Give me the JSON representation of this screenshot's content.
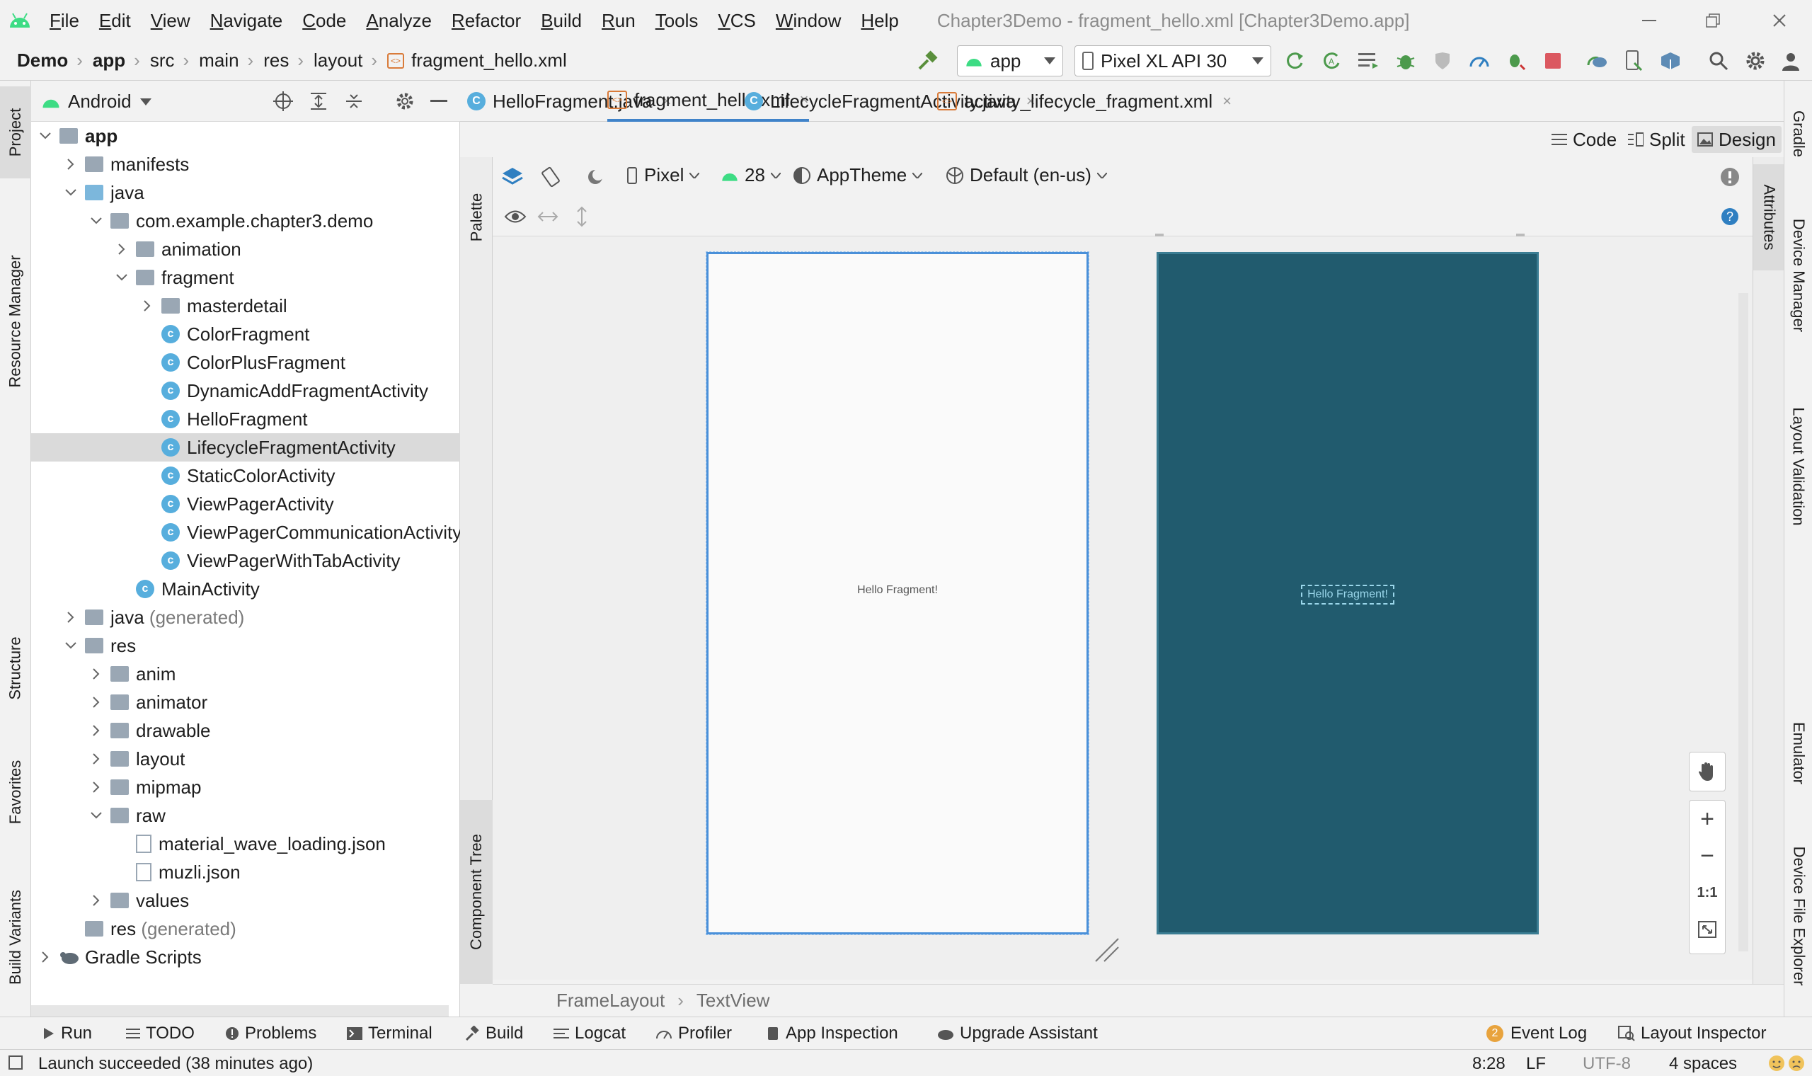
{
  "menu": [
    "File",
    "Edit",
    "View",
    "Navigate",
    "Code",
    "Analyze",
    "Refactor",
    "Build",
    "Run",
    "Tools",
    "VCS",
    "Window",
    "Help"
  ],
  "window_title": "Chapter3Demo - fragment_hello.xml [Chapter3Demo.app]",
  "breadcrumbs": [
    "Demo",
    "app",
    "src",
    "main",
    "res",
    "layout",
    "fragment_hello.xml"
  ],
  "run_config": "app",
  "device": "Pixel XL API 30",
  "left_tabs": [
    "Project",
    "Resource Manager",
    "Structure",
    "Favorites",
    "Build Variants"
  ],
  "project_view": "Android",
  "tree": [
    {
      "label": "app",
      "level": 0,
      "type": "module",
      "expanded": true
    },
    {
      "label": "manifests",
      "level": 1,
      "type": "folder",
      "expanded": false
    },
    {
      "label": "java",
      "level": 1,
      "type": "folder",
      "expanded": true
    },
    {
      "label": "com.example.chapter3.demo",
      "level": 2,
      "type": "package",
      "expanded": true
    },
    {
      "label": "animation",
      "level": 3,
      "type": "package",
      "expanded": false
    },
    {
      "label": "fragment",
      "level": 3,
      "type": "package",
      "expanded": true
    },
    {
      "label": "masterdetail",
      "level": 4,
      "type": "package",
      "expanded": false
    },
    {
      "label": "ColorFragment",
      "level": 4,
      "type": "class"
    },
    {
      "label": "ColorPlusFragment",
      "level": 4,
      "type": "class"
    },
    {
      "label": "DynamicAddFragmentActivity",
      "level": 4,
      "type": "class"
    },
    {
      "label": "HelloFragment",
      "level": 4,
      "type": "class"
    },
    {
      "label": "LifecycleFragmentActivity",
      "level": 4,
      "type": "class",
      "selected": true
    },
    {
      "label": "StaticColorActivity",
      "level": 4,
      "type": "class"
    },
    {
      "label": "ViewPagerActivity",
      "level": 4,
      "type": "class"
    },
    {
      "label": "ViewPagerCommunicationActivity",
      "level": 4,
      "type": "class"
    },
    {
      "label": "ViewPagerWithTabActivity",
      "level": 4,
      "type": "class"
    },
    {
      "label": "MainActivity",
      "level": 3,
      "type": "class"
    },
    {
      "label": "java",
      "suffix": " (generated)",
      "level": 1,
      "type": "folder",
      "expanded": false
    },
    {
      "label": "res",
      "level": 1,
      "type": "folder",
      "expanded": true
    },
    {
      "label": "anim",
      "level": 2,
      "type": "folder",
      "expanded": false
    },
    {
      "label": "animator",
      "level": 2,
      "type": "folder",
      "expanded": false
    },
    {
      "label": "drawable",
      "level": 2,
      "type": "folder",
      "expanded": false
    },
    {
      "label": "layout",
      "level": 2,
      "type": "folder",
      "expanded": false
    },
    {
      "label": "mipmap",
      "level": 2,
      "type": "folder",
      "expanded": false
    },
    {
      "label": "raw",
      "level": 2,
      "type": "folder",
      "expanded": true
    },
    {
      "label": "material_wave_loading.json",
      "level": 3,
      "type": "file"
    },
    {
      "label": "muzli.json",
      "level": 3,
      "type": "file"
    },
    {
      "label": "values",
      "level": 2,
      "type": "folder",
      "expanded": false
    },
    {
      "label": "res",
      "suffix": " (generated)",
      "level": 1,
      "type": "folder"
    },
    {
      "label": "Gradle Scripts",
      "level": 0,
      "type": "gradle",
      "expanded": false
    }
  ],
  "editor_tabs": [
    {
      "label": "HelloFragment.java",
      "type": "java",
      "active": false
    },
    {
      "label": "fragment_hello.xml",
      "type": "xml",
      "active": true
    },
    {
      "label": "LifecycleFragmentActivity.java",
      "type": "java",
      "active": false
    },
    {
      "label": "activity_lifecycle_fragment.xml",
      "type": "xml",
      "active": false
    }
  ],
  "view_modes": {
    "code": "Code",
    "split": "Split",
    "design": "Design"
  },
  "design_toolbar": {
    "device": "Pixel",
    "api": "28",
    "theme": "AppTheme",
    "locale": "Default (en-us)"
  },
  "palette_label": "Palette",
  "component_tree_label": "Component Tree",
  "attributes_label": "Attributes",
  "preview_text": "Hello Fragment!",
  "blueprint_text": "Hello Fragment!",
  "zoom": {
    "plus": "+",
    "minus": "−",
    "one_to_one": "1:1"
  },
  "layout_breadcrumb": [
    "FrameLayout",
    "TextView"
  ],
  "right_tabs": [
    "Gradle",
    "Device Manager",
    "Layout Validation",
    "Emulator",
    "Device File Explorer"
  ],
  "bottom_tools": [
    "Run",
    "TODO",
    "Problems",
    "Terminal",
    "Build",
    "Logcat",
    "Profiler",
    "App Inspection",
    "Upgrade Assistant"
  ],
  "event_log": {
    "count": "2",
    "label": "Event Log"
  },
  "layout_inspector": "Layout Inspector",
  "status": {
    "message": "Launch succeeded (38 minutes ago)",
    "position": "8:28",
    "line_sep": "LF",
    "encoding": "UTF-8",
    "indent": "4 spaces"
  },
  "colors": {
    "accent": "#4083c9",
    "blueprint": "#215b6e",
    "android_green": "#3ddc84",
    "selected_row": "#dadada"
  }
}
